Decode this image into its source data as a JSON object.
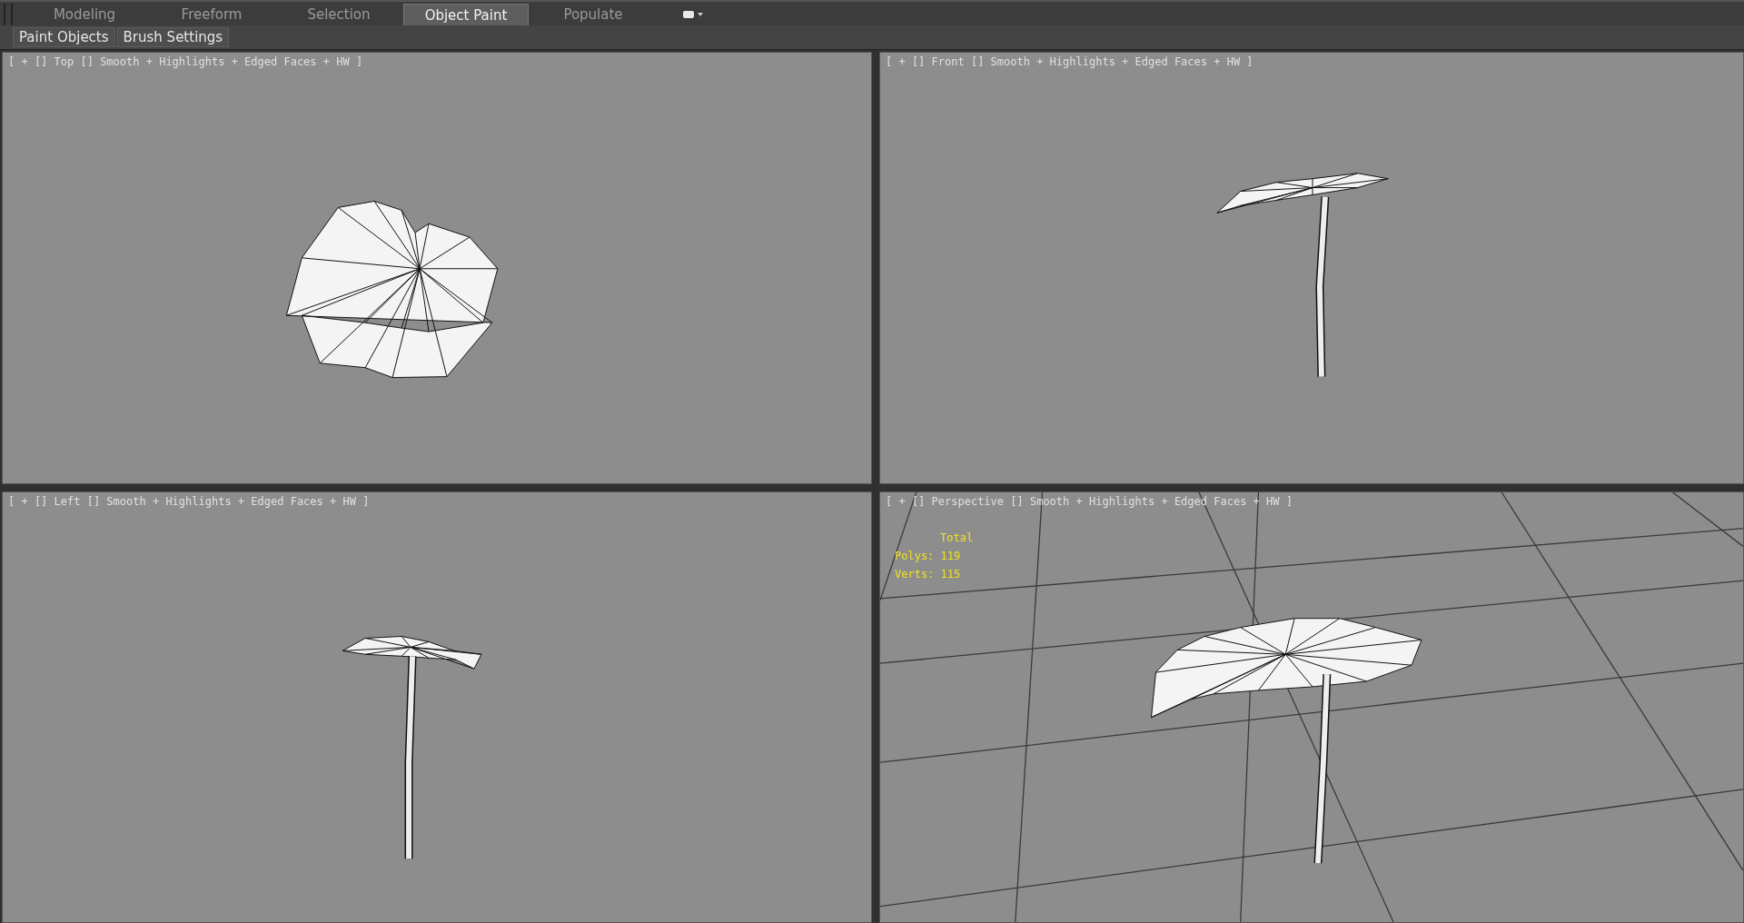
{
  "ribbon_tabs": [
    {
      "label": "Modeling",
      "selected": false
    },
    {
      "label": "Freeform",
      "selected": false
    },
    {
      "label": "Selection",
      "selected": false
    },
    {
      "label": "Object Paint",
      "selected": true
    },
    {
      "label": "Populate",
      "selected": false
    }
  ],
  "panel_buttons": [
    "Paint Objects",
    "Brush Settings"
  ],
  "viewports": [
    {
      "kind": "top",
      "label": "[ + [] Top [] Smooth + Highlights + Edged Faces + HW ]"
    },
    {
      "kind": "front",
      "label": "[ + [] Front [] Smooth + Highlights + Edged Faces + HW ]"
    },
    {
      "kind": "left",
      "label": "[ + [] Left [] Smooth + Highlights + Edged Faces + HW ]"
    },
    {
      "kind": "perspective",
      "label": "[ + [] Perspective [] Smooth + Highlights + Edged Faces + HW ]",
      "stats": {
        "title": "Total",
        "lines": [
          "Polys: 119",
          "Verts: 115"
        ]
      }
    }
  ]
}
